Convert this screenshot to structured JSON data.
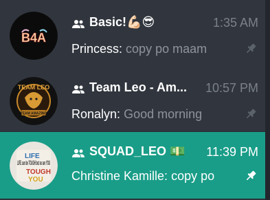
{
  "chats": [
    {
      "name": "Basic!💪🏻😎",
      "time": "1:35 AM",
      "sender": "Princess:",
      "message": "copy po maam",
      "active": false
    },
    {
      "name": "Team Leo - Am...",
      "time": "10:57 PM",
      "sender": "Ronalyn:",
      "message": "Good morning",
      "active": false,
      "avatar_text": "TEAM LEO",
      "avatar_subtext": "TEAM AMAZING"
    },
    {
      "name": "SQUAD_LEO 💵",
      "time": "11:39 PM",
      "sender": "Christine Kamille:",
      "message": "copy po",
      "active": true,
      "avatar_text": "LIFE can be TOUGH but so are YOU"
    }
  ],
  "colors": {
    "active_row": "#199d88",
    "row_bg": "#31363e",
    "muted_text": "#8e949b"
  },
  "icons": {
    "group": "group-icon",
    "pin": "pin-icon"
  }
}
